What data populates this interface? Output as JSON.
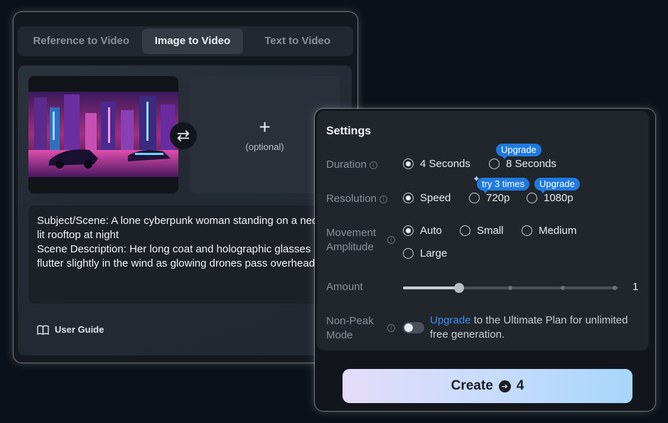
{
  "tabs": [
    {
      "label": "Reference to Video"
    },
    {
      "label": "Image to Video"
    },
    {
      "label": "Text to Video"
    }
  ],
  "upload": {
    "optional_label": "(optional)",
    "plus_glyph": "+",
    "swap_glyph": "⇄"
  },
  "prompt": {
    "line1": "Subject/Scene: A lone cyberpunk woman standing on a neon-lit rooftop at night",
    "line2": "Scene Description: Her long coat and holographic glasses flutter slightly in the wind as glowing drones pass overhead."
  },
  "guide": {
    "label": "User Guide",
    "icon": "book-icon"
  },
  "settings": {
    "title": "Settings",
    "duration": {
      "label": "Duration",
      "options": [
        "4 Seconds",
        "8 Seconds"
      ],
      "selected": "4 Seconds",
      "badge": "Upgrade"
    },
    "resolution": {
      "label": "Resolution",
      "options": [
        "Speed",
        "720p",
        "1080p"
      ],
      "selected": "Speed",
      "badge_720": "try 3 times",
      "badge_1080": "Upgrade"
    },
    "movement": {
      "label_line1": "Movement",
      "label_line2": "Amplitude",
      "options": [
        "Auto",
        "Small",
        "Medium",
        "Large"
      ],
      "selected": "Auto"
    },
    "amount": {
      "label": "Amount",
      "value": "1",
      "level": 0.26
    },
    "nonpeak": {
      "label_line1": "Non-Peak",
      "label_line2": "Mode",
      "link": "Upgrade",
      "text": " to the Ultimate Plan for unlimited free generation.",
      "enabled": false
    }
  },
  "create": {
    "label": "Create",
    "cost": "4"
  },
  "colors": {
    "accent": "#1f7ae0",
    "link": "#3a8ff0"
  }
}
